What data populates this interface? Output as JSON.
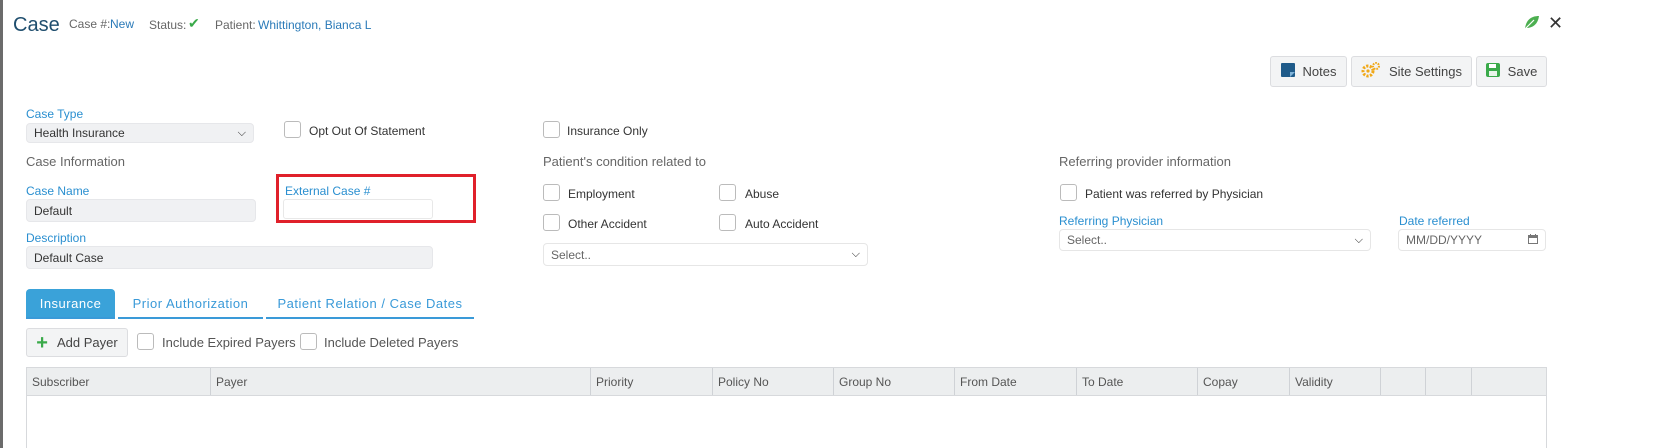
{
  "header": {
    "title": "Case",
    "case_no_label": "Case #:",
    "case_no_value": "New",
    "status_label": "Status:",
    "patient_label": "Patient:",
    "patient_value": "Whittington, Bianca L"
  },
  "toolbar": {
    "notes_label": "Notes",
    "site_settings_label": "Site Settings",
    "save_label": "Save"
  },
  "case_type": {
    "label": "Case Type",
    "value": "Health Insurance"
  },
  "checks": {
    "opt_out": "Opt Out Of Statement",
    "insurance_only": "Insurance Only"
  },
  "case_info": {
    "heading": "Case Information",
    "case_name_label": "Case Name",
    "case_name_value": "Default",
    "external_case_label": "External Case #",
    "external_case_value": "",
    "description_label": "Description",
    "description_value": "Default Case"
  },
  "condition": {
    "heading": "Patient's condition related to",
    "employment": "Employment",
    "abuse": "Abuse",
    "other_accident": "Other Accident",
    "auto_accident": "Auto Accident",
    "select_placeholder": "Select.."
  },
  "referring": {
    "heading": "Referring provider information",
    "referred_check": "Patient was referred by Physician",
    "physician_label": "Referring Physician",
    "physician_placeholder": "Select..",
    "date_label": "Date referred",
    "date_placeholder": "MM/DD/YYYY"
  },
  "tabs": [
    {
      "label": "Insurance"
    },
    {
      "label": "Prior Authorization"
    },
    {
      "label": "Patient Relation / Case Dates"
    }
  ],
  "insurance": {
    "add_payer_label": "Add Payer",
    "include_expired": "Include Expired Payers",
    "include_deleted": "Include Deleted Payers"
  },
  "grid": {
    "columns": [
      "Subscriber",
      "Payer",
      "Priority",
      "Policy No",
      "Group No",
      "From Date",
      "To Date",
      "Copay",
      "Validity",
      "",
      "",
      ""
    ]
  },
  "colors": {
    "accent": "#3aa2d9",
    "highlight_box": "#e0202a",
    "status_check": "#3aaa4a"
  }
}
